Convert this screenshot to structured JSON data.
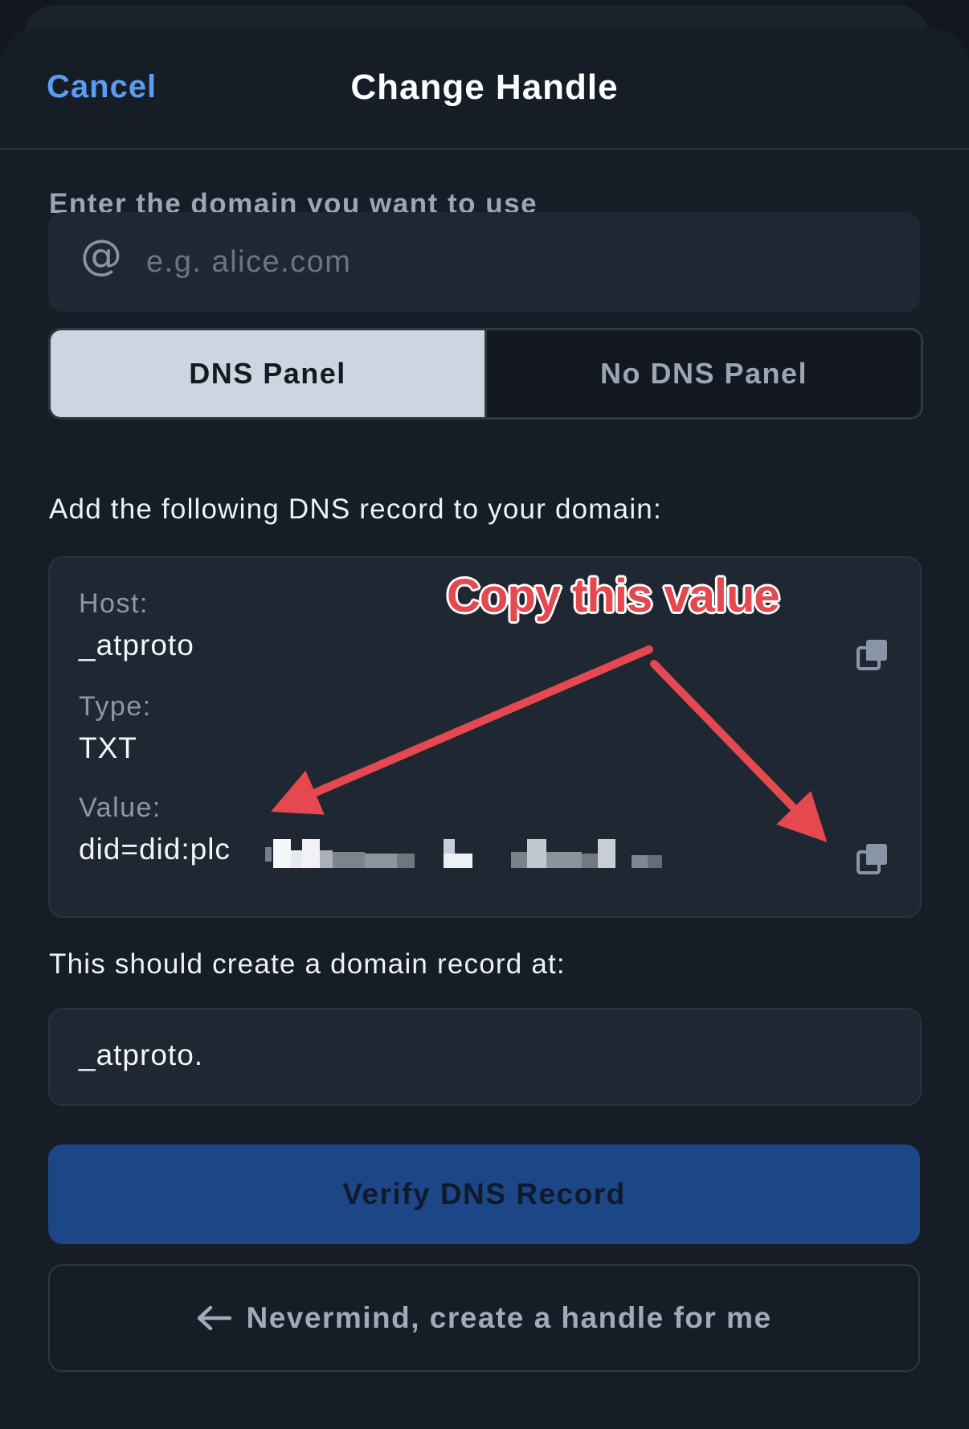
{
  "header": {
    "cancel_label": "Cancel",
    "title": "Change Handle"
  },
  "domain_prompt": "Enter the domain you want to use",
  "domain_input": {
    "value": "",
    "placeholder": "e.g. alice.com",
    "icon": "at-sign-icon"
  },
  "tabs": [
    {
      "label": "DNS Panel",
      "active": true
    },
    {
      "label": "No DNS Panel",
      "active": false
    }
  ],
  "instruction": "Add the following DNS record to your domain:",
  "record": {
    "host_label": "Host:",
    "host_value": "_atproto",
    "type_label": "Type:",
    "type_value": "TXT",
    "value_label": "Value:",
    "value_prefix": "did=did:plc"
  },
  "annotation": {
    "text": "Copy this value",
    "color": "#e5484f"
  },
  "result_prompt": "This should create a domain record at:",
  "result_value": "_atproto.",
  "verify_button": "Verify DNS Record",
  "nevermind_button": "Nevermind, create a handle for me",
  "colors": {
    "accent": "#5a9cf2",
    "primary_button": "#1d4687",
    "background": "#161d27",
    "field": "#1f2733"
  }
}
